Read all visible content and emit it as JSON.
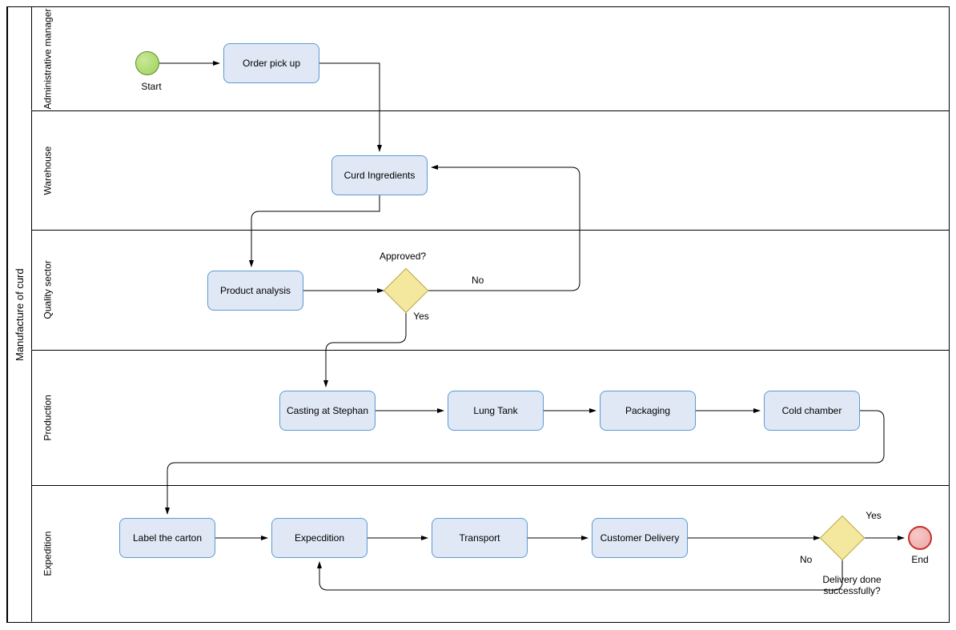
{
  "pool_title": "Manufacture of curd",
  "lanes": {
    "admin": "Administrative manager",
    "warehouse": "Warehouse",
    "quality": "Quality sector",
    "production": "Production",
    "expedition": "Expedition"
  },
  "events": {
    "start_label": "Start",
    "end_label": "End"
  },
  "tasks": {
    "order_pickup": "Order pick up",
    "curd_ingredients": "Curd Ingredients",
    "product_analysis": "Product analysis",
    "casting": "Casting at Stephan",
    "lung_tank": "Lung Tank",
    "packaging": "Packaging",
    "cold_chamber": "Cold chamber",
    "label_carton": "Label the carton",
    "expedition": "Expecdition",
    "transport": "Transport",
    "customer_delivery": "Customer Delivery"
  },
  "gateways": {
    "approved": "Approved?",
    "approved_yes": "Yes",
    "approved_no": "No",
    "delivery_done": "Delivery done successfully?",
    "delivery_yes": "Yes",
    "delivery_no": "No"
  }
}
